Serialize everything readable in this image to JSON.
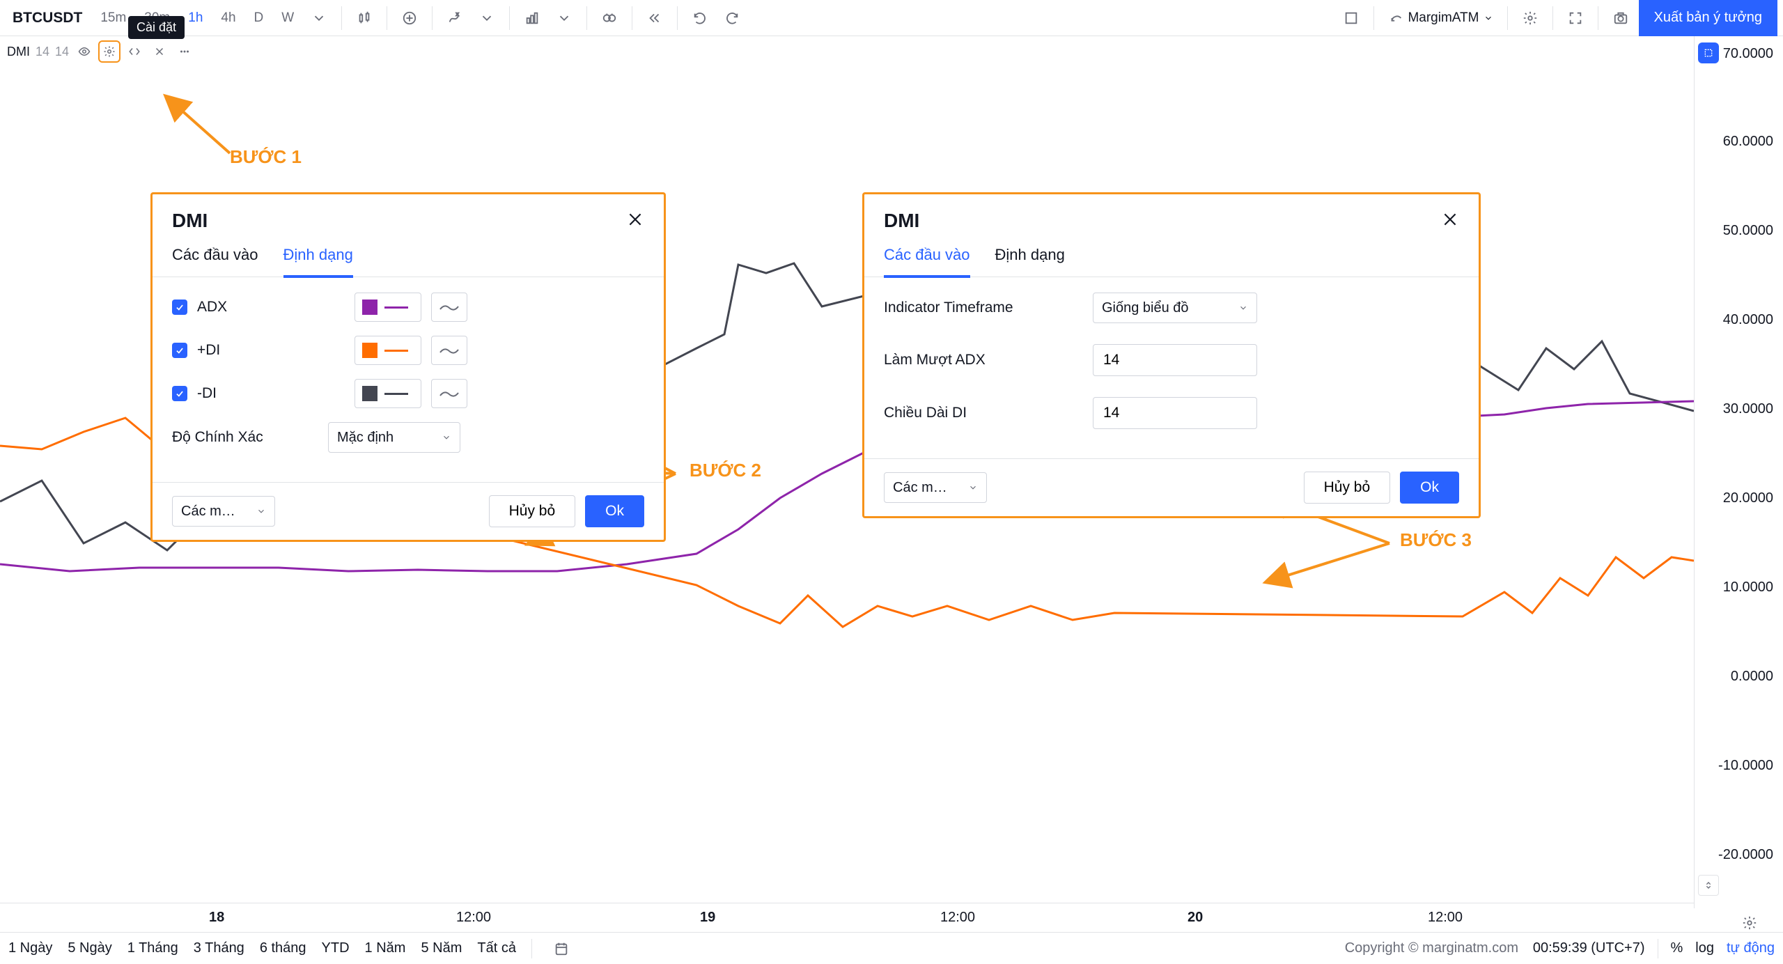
{
  "toolbar": {
    "symbol": "BTCUSDT",
    "timeframes": [
      "15m",
      "30m",
      "1h",
      "4h",
      "D",
      "W"
    ],
    "active_tf": "1h",
    "user": "MargimATM",
    "publish": "Xuất bản ý tưởng",
    "tooltip": "Cài đặt"
  },
  "legend": {
    "name": "DMI",
    "p1": "14",
    "p2": "14"
  },
  "yaxis": [
    "70.0000",
    "60.0000",
    "50.0000",
    "40.0000",
    "30.0000",
    "20.0000",
    "10.0000",
    "0.0000",
    "-10.0000",
    "-20.0000"
  ],
  "xaxis": [
    "18",
    "12:00",
    "19",
    "12:00",
    "20",
    "12:00"
  ],
  "bottom_ranges": [
    "1 Ngày",
    "5 Ngày",
    "1 Tháng",
    "3 Tháng",
    "6 tháng",
    "YTD",
    "1 Năm",
    "5 Năm",
    "Tất cả"
  ],
  "bottom_right": {
    "clock": "00:59:39 (UTC+7)",
    "pct": "%",
    "log": "log",
    "auto": "tự động"
  },
  "copyright": "Copyright © marginatm.com",
  "steps": {
    "s1": "BƯỚC 1",
    "s2": "BƯỚC 2",
    "s3": "BƯỚC 3"
  },
  "modal1": {
    "title": "DMI",
    "tabs": {
      "inputs": "Các đầu vào",
      "style": "Định dạng"
    },
    "rows": {
      "adx": {
        "label": "ADX",
        "color": "#8e24aa"
      },
      "pdi": {
        "label": "+DI",
        "color": "#ff6d00"
      },
      "mdi": {
        "label": "-DI",
        "color": "#434651"
      }
    },
    "precision": {
      "label": "Độ Chính Xác",
      "value": "Mặc định"
    },
    "footer": {
      "defaults": "Các m…",
      "cancel": "Hủy bỏ",
      "ok": "Ok"
    }
  },
  "modal2": {
    "title": "DMI",
    "tabs": {
      "inputs": "Các đầu vào",
      "style": "Định dạng"
    },
    "rows": {
      "tf": {
        "label": "Indicator Timeframe",
        "value": "Giống biểu đồ"
      },
      "adx": {
        "label": "Làm Mượt ADX",
        "value": "14"
      },
      "di": {
        "label": "Chiều Dài DI",
        "value": "14"
      }
    },
    "footer": {
      "defaults": "Các m…",
      "cancel": "Hủy bỏ",
      "ok": "Ok"
    }
  },
  "chart_data": {
    "type": "line",
    "ylim": [
      -20,
      70
    ],
    "x": [
      "18 00:00",
      "18 12:00",
      "19 00:00",
      "19 12:00",
      "20 00:00",
      "20 12:00"
    ],
    "series": [
      {
        "name": "ADX",
        "color": "#8e24aa",
        "approx_values": [
          16,
          16,
          16,
          18,
          22,
          28,
          30,
          30
        ]
      },
      {
        "name": "+DI",
        "color": "#ff6d00",
        "approx_values": [
          26,
          28,
          24,
          14,
          12,
          10,
          10,
          14,
          15
        ]
      },
      {
        "name": "-DI",
        "color": "#434651",
        "approx_values": [
          20,
          26,
          24,
          24,
          46,
          48,
          44,
          36,
          38,
          30
        ]
      }
    ]
  }
}
